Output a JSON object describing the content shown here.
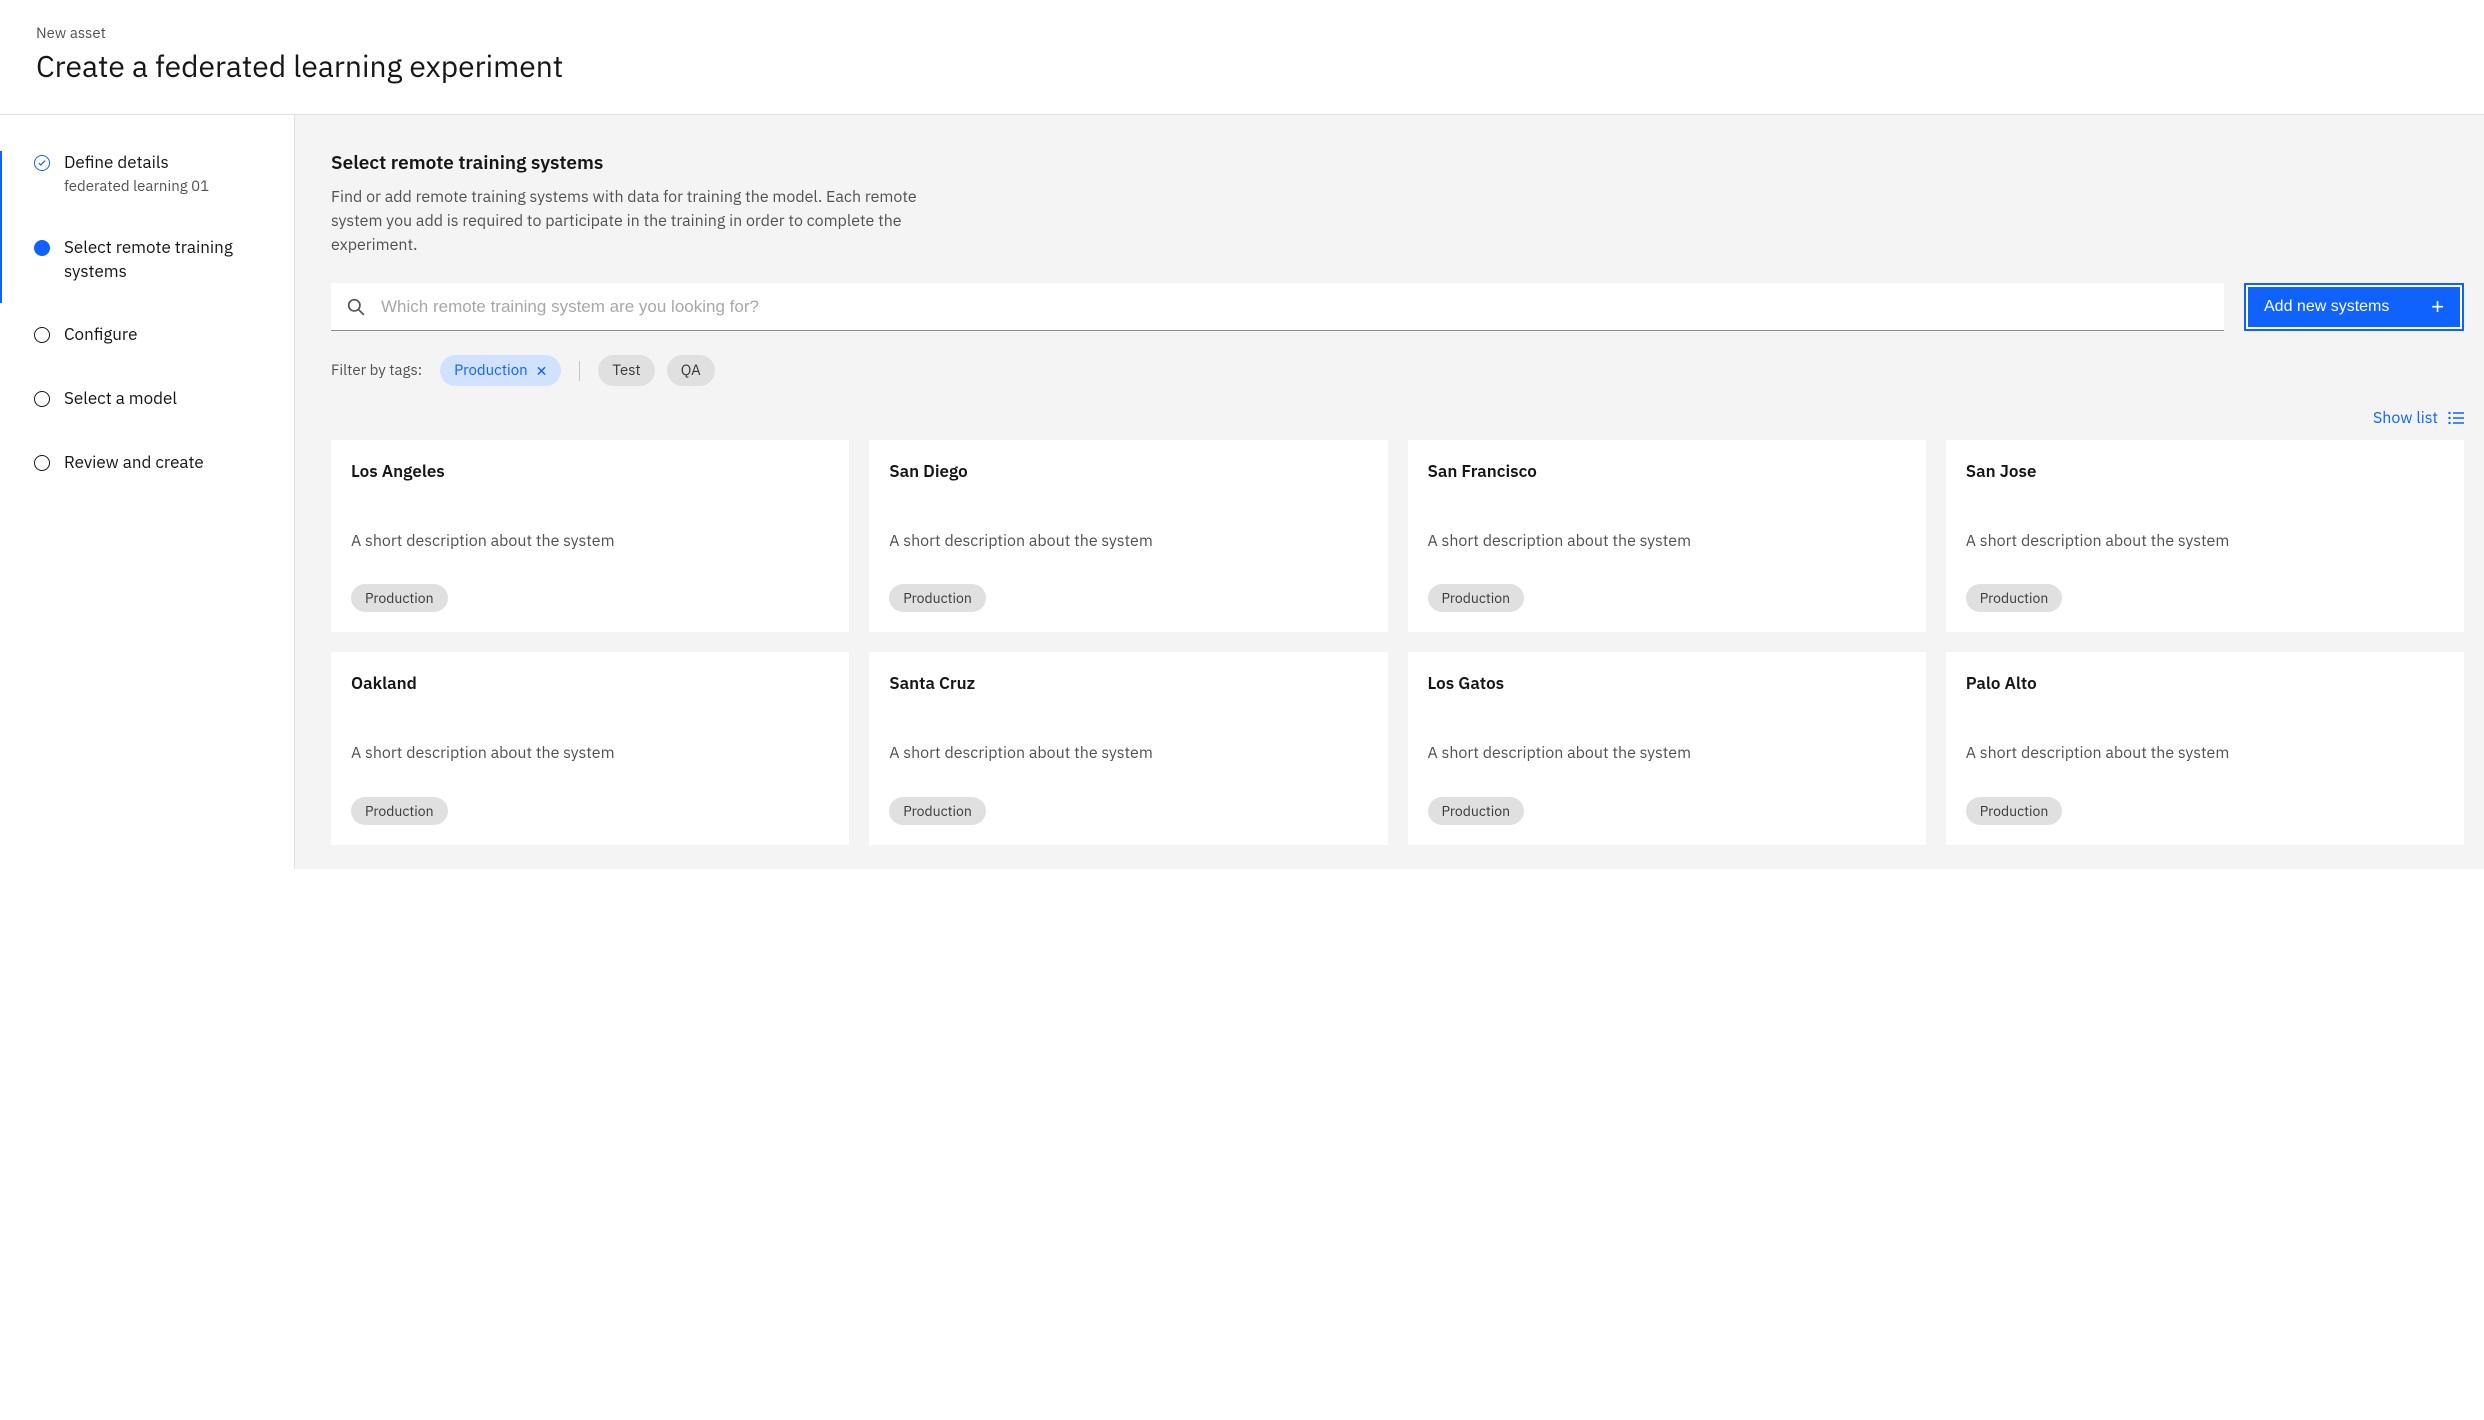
{
  "header": {
    "breadcrumb": "New asset",
    "title": "Create a federated learning experiment"
  },
  "sidebar": {
    "steps": [
      {
        "label": "Define details",
        "sublabel": "federated learning 01",
        "state": "completed"
      },
      {
        "label": "Select remote training systems",
        "sublabel": "",
        "state": "active"
      },
      {
        "label": "Configure",
        "sublabel": "",
        "state": "pending"
      },
      {
        "label": "Select a model",
        "sublabel": "",
        "state": "pending"
      },
      {
        "label": "Review and create",
        "sublabel": "",
        "state": "pending"
      }
    ]
  },
  "main": {
    "section_title": "Select remote training systems",
    "section_description": "Find or add remote training systems with data for training the model. Each remote system you add is required to participate in the training in order to complete the experiment.",
    "search_placeholder": "Which remote training system are you looking for?",
    "add_button_label": "Add new systems",
    "filter_label": "Filter by tags:",
    "filter_tags": {
      "active": [
        {
          "label": "Production"
        }
      ],
      "inactive": [
        {
          "label": "Test"
        },
        {
          "label": "QA"
        }
      ]
    },
    "show_list_label": "Show list",
    "cards": [
      {
        "title": "Los Angeles",
        "description": "A short description about the system",
        "tag": "Production"
      },
      {
        "title": "San Diego",
        "description": "A short description about the system",
        "tag": "Production"
      },
      {
        "title": "San Francisco",
        "description": "A short description about the system",
        "tag": "Production"
      },
      {
        "title": "San Jose",
        "description": "A short description about the system",
        "tag": "Production"
      },
      {
        "title": "Oakland",
        "description": "A short description about the system",
        "tag": "Production"
      },
      {
        "title": "Santa Cruz",
        "description": "A short description about the system",
        "tag": "Production"
      },
      {
        "title": "Los Gatos",
        "description": "A short description about the system",
        "tag": "Production"
      },
      {
        "title": "Palo Alto",
        "description": "A short description about the system",
        "tag": "Production"
      }
    ]
  }
}
